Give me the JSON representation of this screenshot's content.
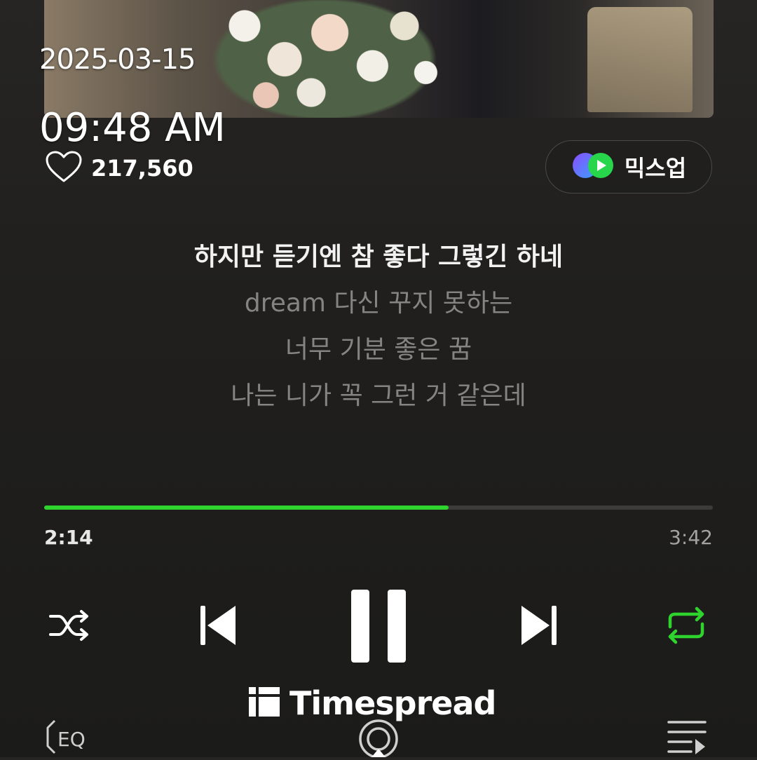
{
  "overlay": {
    "date": "2025-03-15",
    "time": "09:48 AM"
  },
  "album_art": {
    "icon": "album-cover-image"
  },
  "like": {
    "icon": "heart-outline-icon",
    "count": "217,560"
  },
  "mixup": {
    "icon": "mixup-logo-icon",
    "label": "믹스업"
  },
  "lyrics": {
    "lines": [
      "하지만 듣기엔 참 좋다 그렇긴 하네",
      "dream 다신 꾸지 못하는",
      "너무 기분 좋은 꿈",
      "나는 니가 꼭 그런 거 같은데"
    ]
  },
  "player": {
    "elapsed": "2:14",
    "total": "3:42",
    "progress_fraction": 0.605,
    "accent_color": "#2fd32d"
  },
  "controls": {
    "shuffle_icon": "shuffle-icon",
    "prev_icon": "skip-previous-icon",
    "play_pause_icon": "pause-icon",
    "next_icon": "skip-next-icon",
    "repeat_icon": "repeat-icon",
    "repeat_active": true
  },
  "watermark": {
    "text": "Timespread",
    "icon": "timespread-logo-icon"
  },
  "bottom_bar": {
    "eq_label": "EQ",
    "eq_icon": "equalizer-icon",
    "cast_icon": "airplay-icon",
    "playlist_icon": "playlist-icon"
  }
}
